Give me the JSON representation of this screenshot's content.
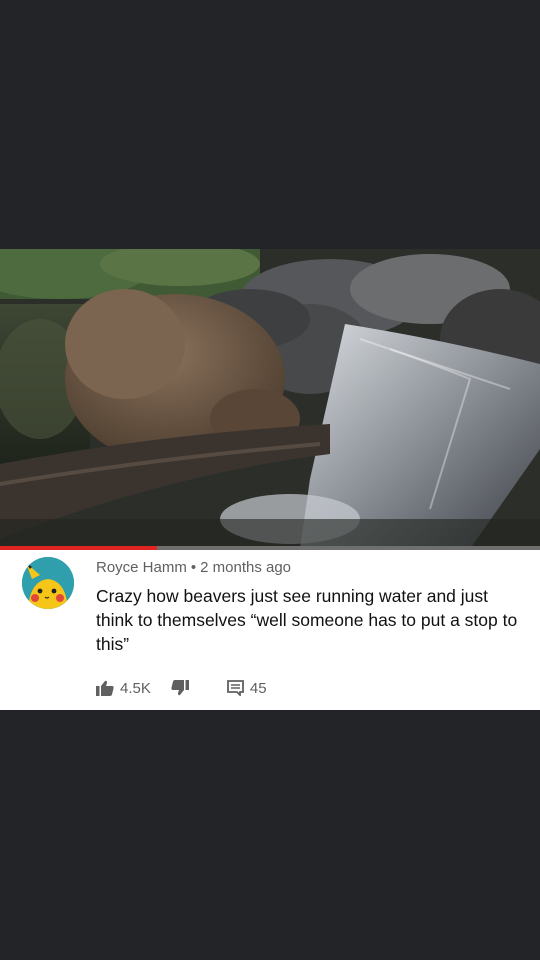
{
  "video": {
    "progress_percent": 29,
    "subject_icon": "beaver-waterfall-photo"
  },
  "comment": {
    "author": "Royce Hamm",
    "separator": "•",
    "time": "2 months ago",
    "text": "Crazy how beavers just see running water and just think to themselves “well someone has to put a stop to this”",
    "likes": "4.5K",
    "replies": "45",
    "avatar_icon": "pikachu-avatar",
    "like_icon": "thumbs-up-icon",
    "dislike_icon": "thumbs-down-icon",
    "reply_icon": "comment-icon"
  },
  "colors": {
    "page_background": "#232427",
    "progress_red": "#e02424",
    "meta_gray": "#606060",
    "text_dark": "#111111"
  }
}
